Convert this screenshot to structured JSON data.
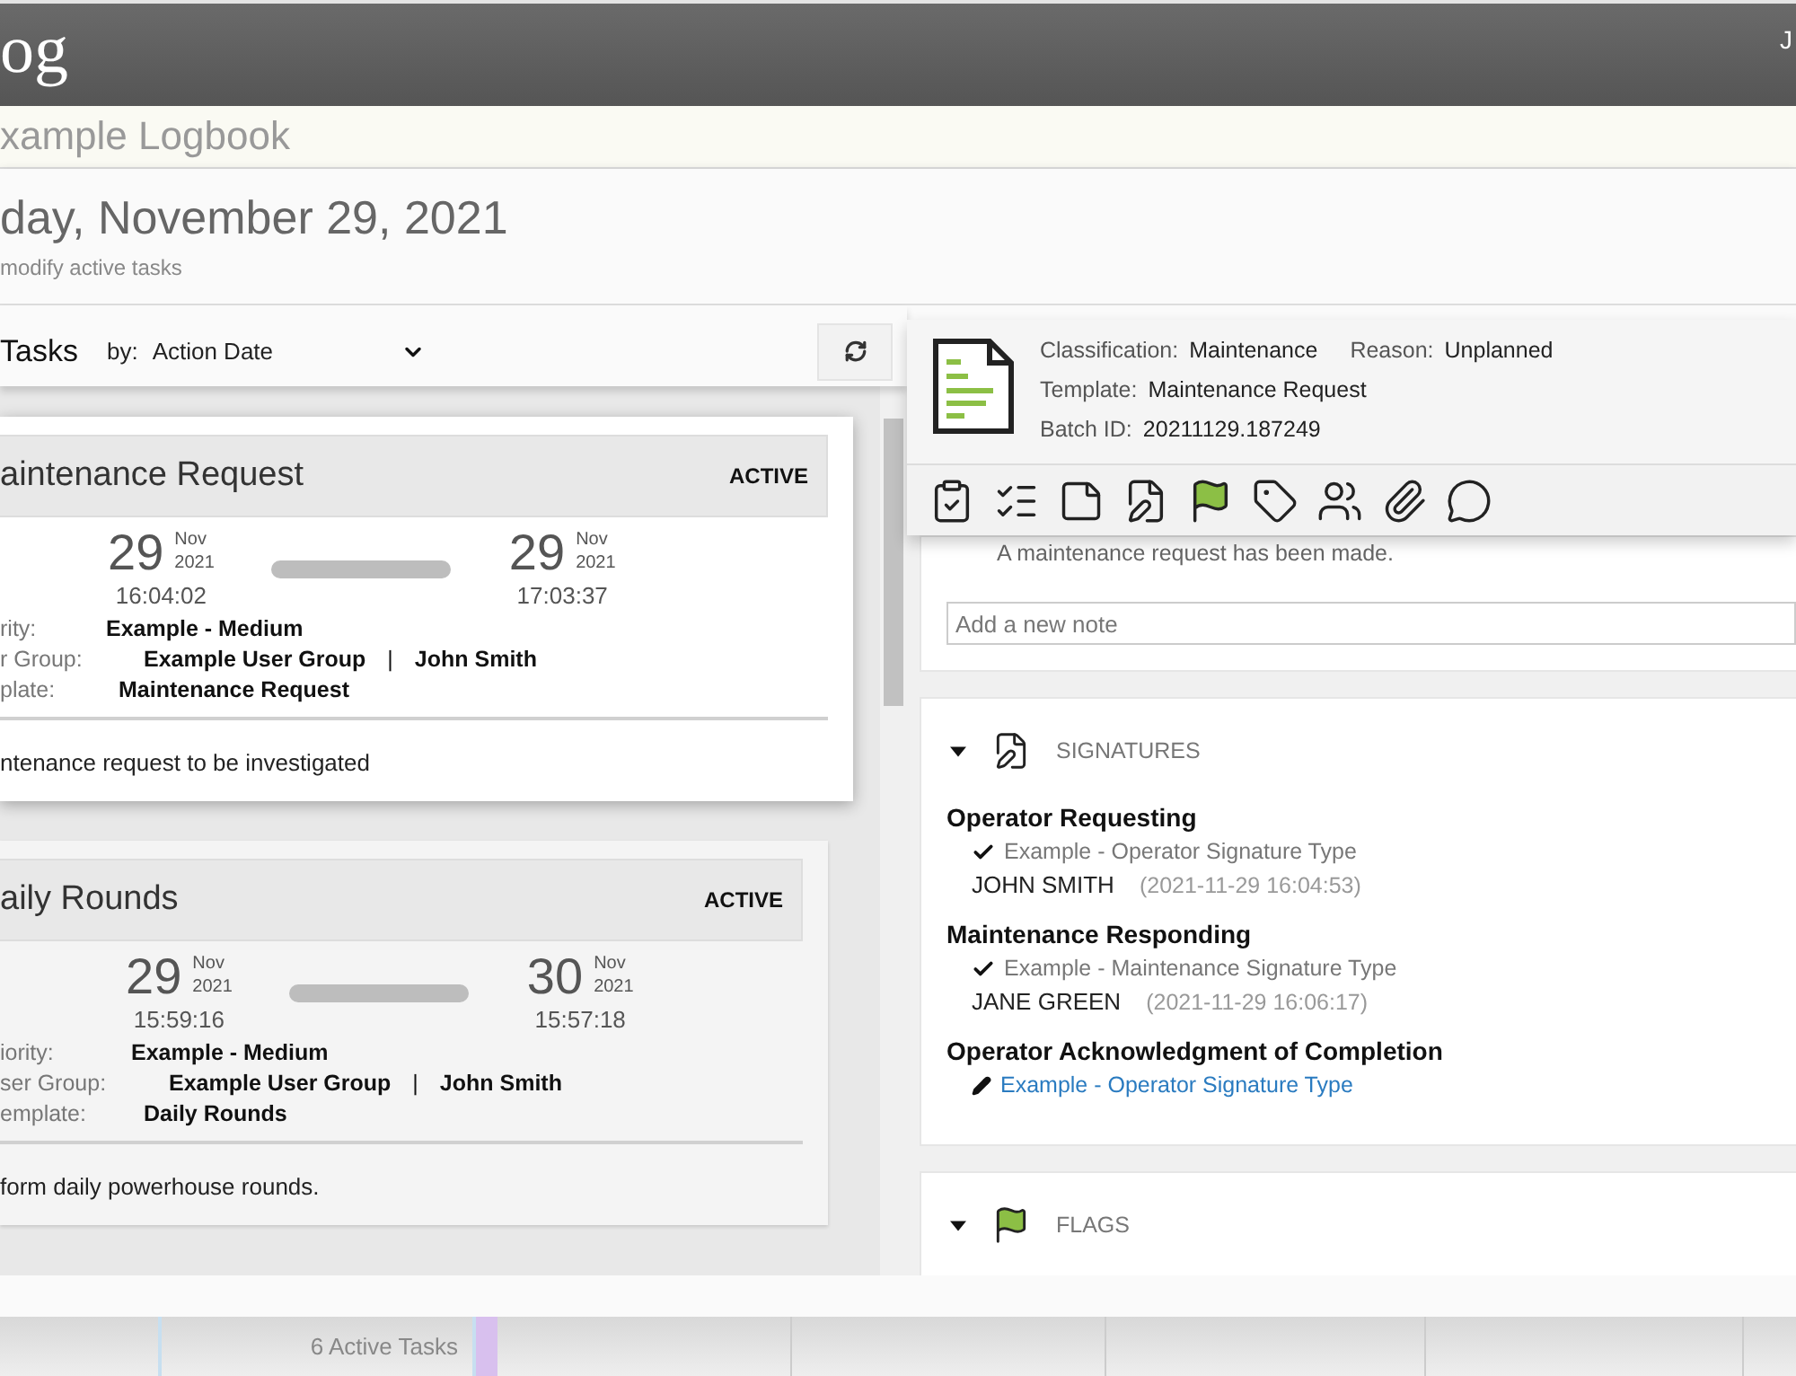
{
  "app_header": {
    "title": "og",
    "user": "J"
  },
  "logbook_name": "xample Logbook",
  "page": {
    "date": "day, November 29, 2021",
    "subtitle": "modify active tasks"
  },
  "tasks_panel": {
    "title": "Tasks",
    "sort_label": "by:",
    "sort_value": "Action Date",
    "tasks": [
      {
        "title": "aintenance Request",
        "status": "ACTIVE",
        "selected": true,
        "start": {
          "day": "29",
          "month": "Nov",
          "year": "2021",
          "time": "16:04:02"
        },
        "end": {
          "day": "29",
          "month": "Nov",
          "year": "2021",
          "time": "17:03:37"
        },
        "fields": [
          {
            "label": "rity:",
            "value": "Example - Medium"
          },
          {
            "label": "r Group:",
            "value": "Example User Group",
            "separator": "|",
            "assignee": "John Smith"
          },
          {
            "label": "plate:",
            "value": "Maintenance Request"
          }
        ],
        "description": "ntenance request to be investigated"
      },
      {
        "title": "aily Rounds",
        "status": "ACTIVE",
        "selected": false,
        "start": {
          "day": "29",
          "month": "Nov",
          "year": "2021",
          "time": "15:59:16"
        },
        "end": {
          "day": "30",
          "month": "Nov",
          "year": "2021",
          "time": "15:57:18"
        },
        "fields": [
          {
            "label": "iority:",
            "value": "Example - Medium"
          },
          {
            "label": "ser Group:",
            "value": "Example User Group",
            "separator": "|",
            "assignee": "John Smith"
          },
          {
            "label": "emplate:",
            "value": "Daily Rounds"
          }
        ],
        "description": "form daily powerhouse rounds."
      }
    ]
  },
  "detail": {
    "rows": [
      [
        {
          "label": "Classification:",
          "value": "Maintenance"
        },
        {
          "label": "Reason:",
          "value": "Unplanned"
        }
      ],
      [
        {
          "label": "Template:",
          "value": "Maintenance Request"
        }
      ],
      [
        {
          "label": "Batch ID:",
          "value": "20211129.187249"
        }
      ]
    ],
    "notes": {
      "note": "A maintenance request has been made.",
      "placeholder": "Add a new note"
    },
    "sections": [
      {
        "kind": "signatures",
        "title": "SIGNATURES",
        "expanded": true,
        "signatures": [
          {
            "role": "Operator Requesting",
            "type": "Example - Operator Signature Type",
            "signed": true,
            "signer": "JOHN SMITH",
            "timestamp": "(2021-11-29 16:04:53)"
          },
          {
            "role": "Maintenance Responding",
            "type": "Example - Maintenance Signature Type",
            "signed": true,
            "signer": "JANE GREEN",
            "timestamp": "(2021-11-29 16:06:17)"
          },
          {
            "role": "Operator Acknowledgment of Completion",
            "type": "Example - Operator Signature Type",
            "signed": false
          }
        ]
      },
      {
        "kind": "flags",
        "title": "FLAGS",
        "expanded": true
      }
    ]
  },
  "calendar_strip": {
    "count_label": "6 Active Tasks"
  }
}
